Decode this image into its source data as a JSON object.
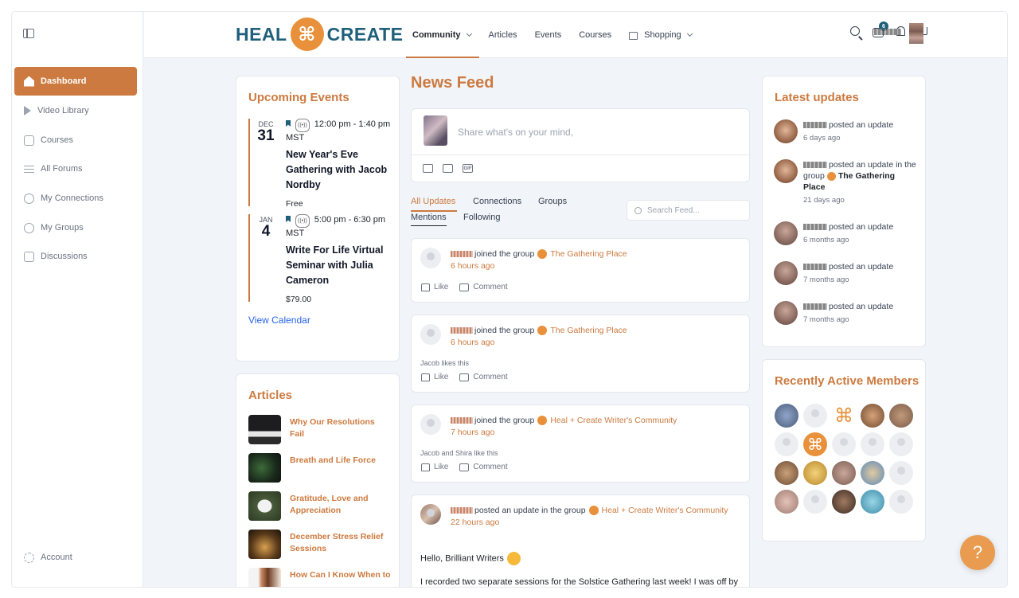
{
  "sidebar": {
    "items": [
      {
        "label": "Dashboard",
        "active": true
      },
      {
        "label": "Video Library"
      },
      {
        "label": "Courses"
      },
      {
        "label": "All Forums"
      },
      {
        "label": "My Connections"
      },
      {
        "label": "My Groups"
      },
      {
        "label": "Discussions"
      }
    ],
    "account": "Account"
  },
  "header": {
    "logo_left": "HEAL",
    "logo_right": "CREATE",
    "nav": [
      "Community",
      "Articles",
      "Events",
      "Courses",
      "Shopping"
    ],
    "inbox_badge": "6"
  },
  "events": {
    "title": "Upcoming Events",
    "items": [
      {
        "month": "DEC",
        "day": "31",
        "time": "12:00 pm - 1:40 pm MST",
        "title": "New Year's Eve Gathering with Jacob Nordby",
        "price": "Free"
      },
      {
        "month": "JAN",
        "day": "4",
        "time": "5:00 pm - 6:30 pm MST",
        "title": "Write For Life Virtual Seminar with Julia Cameron",
        "price": "$79.00"
      }
    ],
    "view_calendar": "View Calendar"
  },
  "articles": {
    "title": "Articles",
    "items": [
      "Why Our Resolutions Fail",
      "Breath and Life Force",
      "Gratitude, Love and Appreciation",
      "December Stress Relief Sessions",
      "How Can I Know When to"
    ]
  },
  "feed": {
    "title": "News Feed",
    "composer_placeholder": "Share what's on your mind,",
    "tabs": [
      "All Updates",
      "Connections",
      "Groups",
      "Mentions",
      "Following"
    ],
    "search_placeholder": "Search Feed...",
    "posts": [
      {
        "action": "joined the group",
        "group": "The Gathering Place",
        "time": "6 hours ago",
        "likes": ""
      },
      {
        "action": "joined the group",
        "group": "The Gathering Place",
        "time": "6 hours ago",
        "likes": "Jacob likes this"
      },
      {
        "action": "joined the group",
        "group": "Heal + Create Writer's Community",
        "time": "7 hours ago",
        "likes": "Jacob and Shira like this"
      },
      {
        "action": "posted an update in the group",
        "group": "Heal + Create Writer's Community",
        "time": "22 hours ago",
        "likes": ""
      }
    ],
    "like_label": "Like",
    "comment_label": "Comment",
    "last_post_greeting": "Hello, Brilliant Writers",
    "last_post_body": "I recorded two separate sessions for the Solstice Gathering last week! I was off by a"
  },
  "latest_updates": {
    "title": "Latest updates",
    "items": [
      {
        "text": "posted an update",
        "group": "",
        "time": "6 days ago"
      },
      {
        "text": "posted an update in the group",
        "group": "The Gathering Place",
        "time": "21 days ago"
      },
      {
        "text": "posted an update",
        "group": "",
        "time": "6 months ago"
      },
      {
        "text": "posted an update",
        "group": "",
        "time": "7 months ago"
      },
      {
        "text": "posted an update",
        "group": "",
        "time": "7 months ago"
      }
    ]
  },
  "recently_active": {
    "title": "Recently Active Members"
  },
  "colors": {
    "accent": "#cc7a3f",
    "brand_blue": "#1f5f7a",
    "logo_orange": "#e8913a"
  }
}
